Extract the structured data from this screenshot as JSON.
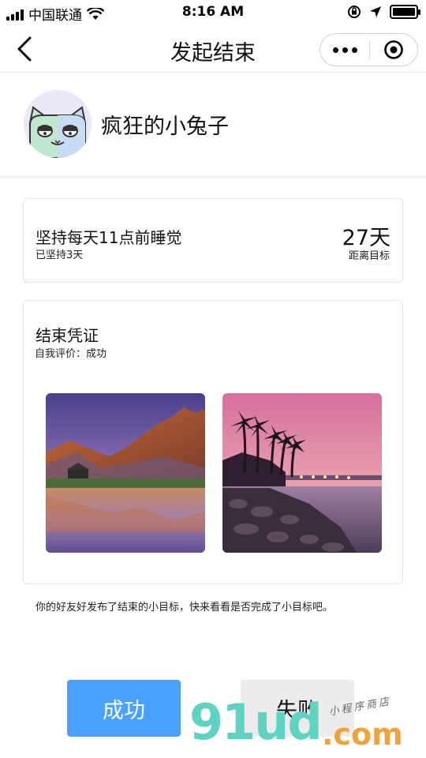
{
  "status_bar": {
    "carrier": "中国联通",
    "time": "8:16 AM"
  },
  "nav": {
    "title": "发起结束"
  },
  "profile": {
    "username": "疯狂的小兔子"
  },
  "goal": {
    "title": "坚持每天11点前睡觉",
    "persisted": "已坚持3天",
    "days": "27天",
    "days_label": "距离目标"
  },
  "proof": {
    "title": "结束凭证",
    "eval_label": "自我评价：",
    "eval_value": "成功"
  },
  "note": "你的好友好发布了结束的小目标，快来看看是否完成了小目标吧。",
  "buttons": {
    "success": "成功",
    "fail": "失败"
  },
  "watermark": {
    "logo": "91ud",
    "domain": ".com",
    "tagline": "小程序商店"
  },
  "colors": {
    "accent": "#4aa1ff",
    "fail_bg": "#ececec"
  },
  "icons": {
    "back": "chevron-left-icon",
    "more": "more-dots-icon",
    "close": "target-close-icon",
    "wifi": "wifi-icon",
    "location": "location-arrow-icon"
  }
}
